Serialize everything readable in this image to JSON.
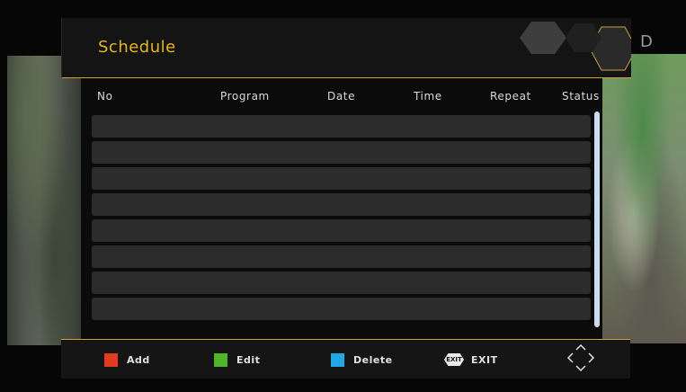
{
  "header": {
    "title": "Schedule",
    "corner_letter": "D"
  },
  "columns": [
    "No",
    "Program",
    "Date",
    "Time",
    "Repeat",
    "Status"
  ],
  "rows": [
    {},
    {},
    {},
    {},
    {},
    {},
    {},
    {}
  ],
  "footer": {
    "keys": [
      {
        "label": "Add",
        "color": "#e23b22",
        "icon": "red-key-icon"
      },
      {
        "label": "Edit",
        "color": "#4fb52a",
        "icon": "green-key-icon"
      },
      {
        "label": "Delete",
        "color": "#22a7e0",
        "icon": "blue-key-icon"
      },
      {
        "label": "EXIT",
        "icon": "exit-key-icon",
        "icon_text": "EXIT"
      }
    ],
    "nav_icon": "direction-pad-icon"
  },
  "colors": {
    "accent": "#e6b422",
    "row": "#2c2c2c",
    "scrollbar": "#c9dcf0"
  }
}
